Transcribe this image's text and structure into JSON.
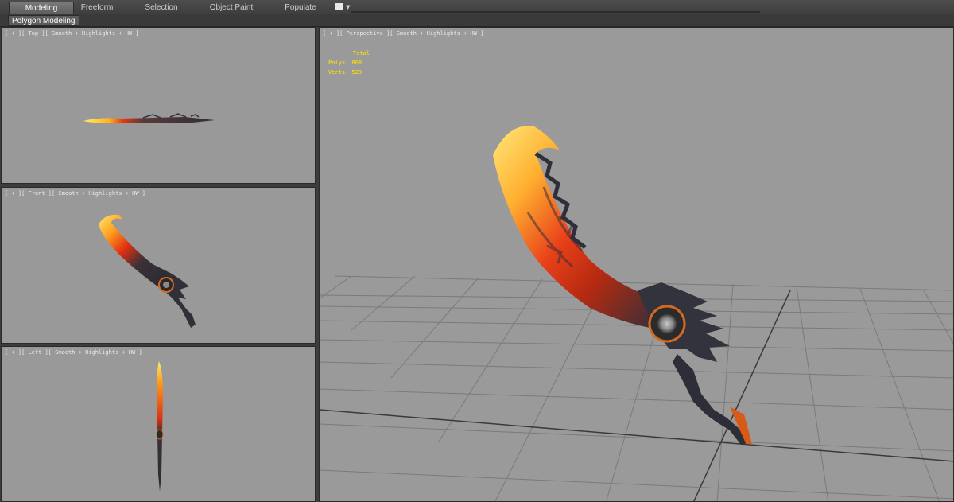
{
  "tabs": [
    {
      "label": "Modeling",
      "active": true
    },
    {
      "label": "Freeform",
      "active": false
    },
    {
      "label": "Selection",
      "active": false
    },
    {
      "label": "Object Paint",
      "active": false
    },
    {
      "label": "Populate",
      "active": false
    }
  ],
  "panel": {
    "label": "Polygon Modeling"
  },
  "viewports": {
    "top": {
      "label": "[ + ][ Top ][ Smooth + Highlights + HW ]"
    },
    "front": {
      "label": "[ + ][ Front ][ Smooth + Highlights + HW ]"
    },
    "left": {
      "label": "[ + ][ Left ][ Smooth + Highlights + HW ]"
    },
    "perspective": {
      "label": "[ + ][ Perspective ][ Smooth + Highlights + HW ]"
    }
  },
  "stats": {
    "header": "Total",
    "polys_label": "Polys:",
    "polys_value": "868",
    "verts_label": "Verts:",
    "verts_value": "529"
  },
  "colors": {
    "viewport_bg": "#999999",
    "stats_text": "#ffe600",
    "active_tab": "#6a6a6a"
  }
}
